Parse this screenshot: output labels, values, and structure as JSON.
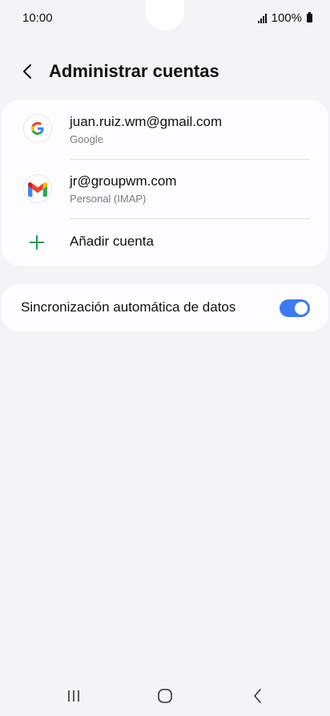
{
  "status": {
    "time": "10:00",
    "battery": "100%"
  },
  "header": {
    "title": "Administrar cuentas"
  },
  "accounts": [
    {
      "email": "juan.ruiz.wm@gmail.com",
      "type": "Google",
      "icon": "google-icon"
    },
    {
      "email": "jr@groupwm.com",
      "type": "Personal (IMAP)",
      "icon": "gmail-icon"
    }
  ],
  "add_account": {
    "label": "Añadir cuenta"
  },
  "sync": {
    "label": "Sincronización automática de datos",
    "enabled": true
  },
  "colors": {
    "accent": "#3e7bf0",
    "add_icon": "#1d9e57",
    "background": "#f4f4f7"
  }
}
